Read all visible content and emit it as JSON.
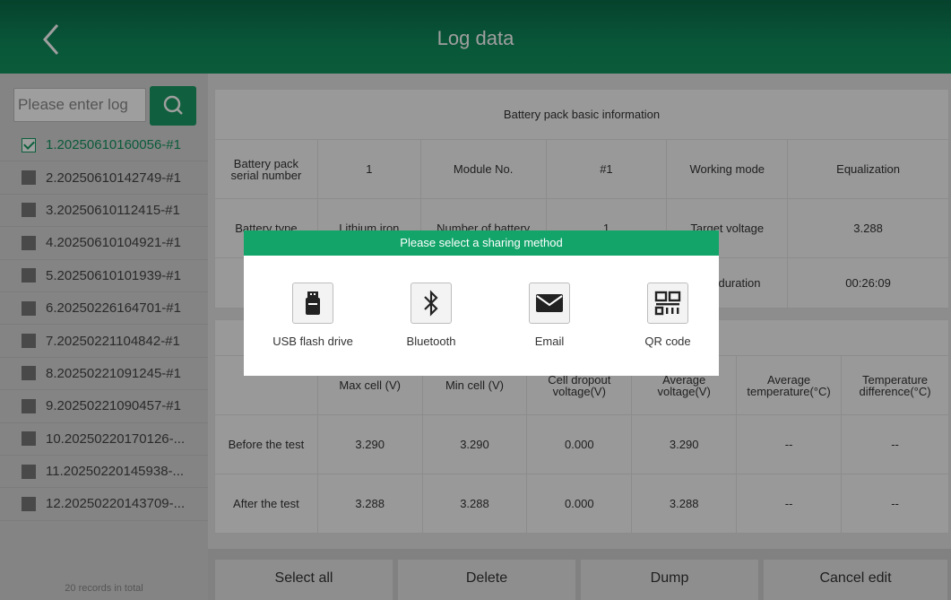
{
  "header": {
    "title": "Log data"
  },
  "sidebar": {
    "search_placeholder": "Please enter log",
    "records": [
      {
        "label": "1.20250610160056-#1",
        "checked": true
      },
      {
        "label": "2.20250610142749-#1",
        "checked": false
      },
      {
        "label": "3.20250610112415-#1",
        "checked": false
      },
      {
        "label": "4.20250610104921-#1",
        "checked": false
      },
      {
        "label": "5.20250610101939-#1",
        "checked": false
      },
      {
        "label": "6.20250226164701-#1",
        "checked": false
      },
      {
        "label": "7.20250221104842-#1",
        "checked": false
      },
      {
        "label": "8.20250221091245-#1",
        "checked": false
      },
      {
        "label": "9.20250221090457-#1",
        "checked": false
      },
      {
        "label": "10.20250220170126-...",
        "checked": false
      },
      {
        "label": "11.20250220145938-...",
        "checked": false
      },
      {
        "label": "12.20250220143709-...",
        "checked": false
      }
    ],
    "total": "20 records in total"
  },
  "basic_info": {
    "title": "Battery pack basic information",
    "row1": {
      "serial_label": "Battery pack serial number",
      "serial_value": "1",
      "module_label": "Module No.",
      "module_value": "#1",
      "mode_label": "Working mode",
      "mode_value": "Equalization"
    },
    "row2": {
      "type_label": "Battery type",
      "type_value": "Lithium iron",
      "count_label": "Number of battery",
      "count_value": "1",
      "target_label": "Target voltage",
      "target_value": "3.288"
    },
    "row3": {
      "duration_label": "Test duration",
      "duration_value": "00:26:09"
    }
  },
  "results": {
    "headers": [
      "Max cell (V)",
      "Min cell (V)",
      "Cell dropout voltage(V)",
      "Average voltage(V)",
      "Average temperature(°C)",
      "Temperature difference(°C)"
    ],
    "rows": [
      {
        "label": "Before the test",
        "values": [
          "3.290",
          "3.290",
          "0.000",
          "3.290",
          "--",
          "--"
        ]
      },
      {
        "label": "After the test",
        "values": [
          "3.288",
          "3.288",
          "0.000",
          "3.288",
          "--",
          "--"
        ]
      }
    ]
  },
  "actions": {
    "select_all": "Select all",
    "delete": "Delete",
    "dump": "Dump",
    "cancel_edit": "Cancel edit"
  },
  "dialog": {
    "title": "Please select a sharing method",
    "options": [
      {
        "label": "USB flash drive",
        "icon": "usb-drive-icon"
      },
      {
        "label": "Bluetooth",
        "icon": "bluetooth-icon"
      },
      {
        "label": "Email",
        "icon": "email-icon"
      },
      {
        "label": "QR code",
        "icon": "qr-code-icon"
      }
    ]
  },
  "colors": {
    "accent": "#13a46a",
    "header": "#0f8c5d"
  }
}
